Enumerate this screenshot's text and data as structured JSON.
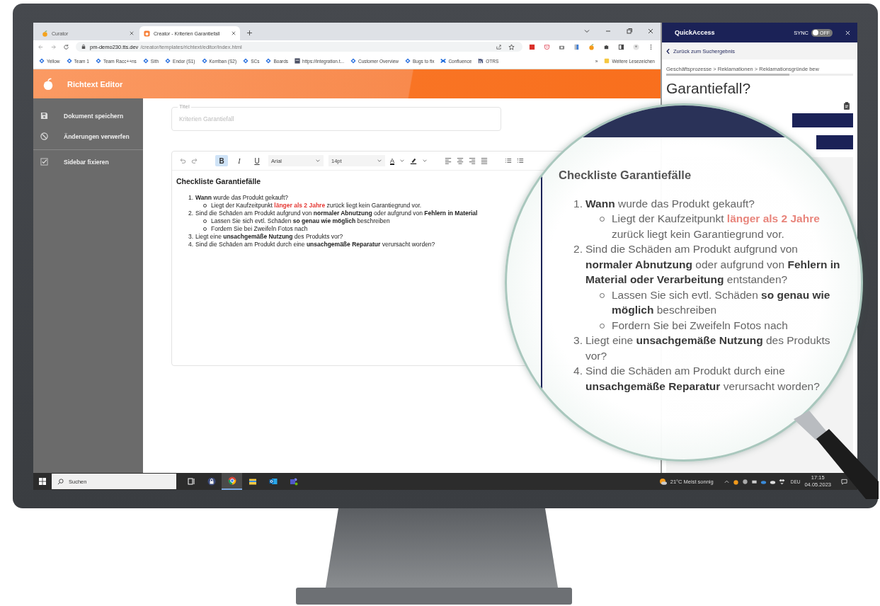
{
  "browser": {
    "tabs": [
      {
        "title": "Curator",
        "kind": "curator",
        "selected": false
      },
      {
        "title": "Creator - Kriterien Garantiefall",
        "kind": "creator",
        "selected": true
      }
    ],
    "url": {
      "host": "pm-demo230.tts.dev",
      "path": "/creator/templates/richtext/editor/index.html"
    },
    "bookmarks": [
      {
        "label": "Yellow",
        "kind": "diamond"
      },
      {
        "label": "Team 1",
        "kind": "diamond"
      },
      {
        "label": "Team Racc++ns",
        "kind": "diamond"
      },
      {
        "label": "Sith",
        "kind": "diamond"
      },
      {
        "label": "Endor (S1)",
        "kind": "diamond"
      },
      {
        "label": "Korriban (S2)",
        "kind": "diamond"
      },
      {
        "label": "SCs",
        "kind": "diamond"
      },
      {
        "label": "Boards",
        "kind": "diamond"
      },
      {
        "label": "https://integration.t...",
        "kind": "tts"
      },
      {
        "label": "Customer Overview",
        "kind": "diamond"
      },
      {
        "label": "Bugs to fix",
        "kind": "diamond"
      },
      {
        "label": "Confluence",
        "kind": "confluence"
      },
      {
        "label": "OTRS",
        "kind": "ttsmark"
      }
    ],
    "more": "»",
    "other_bookmarks": "Weitere Lesezeichen"
  },
  "app": {
    "title": "Richtext Editor",
    "sidebar": [
      {
        "label": "Dokument speichern",
        "kind": "save"
      },
      {
        "label": "Änderungen verwerfen",
        "kind": "discard"
      },
      {
        "label": "Sidebar fixieren",
        "kind": "checkbox",
        "checked": true
      }
    ],
    "title_field": {
      "label": "Titel",
      "value": "Kriterien Garantiefall"
    },
    "toolbar": {
      "format_buttons": [
        {
          "label": "B",
          "kind": "bold",
          "selected": true
        },
        {
          "label": "I",
          "kind": "italic",
          "selected": false
        },
        {
          "label": "U",
          "kind": "underline",
          "selected": false
        }
      ],
      "font": "Arial",
      "size": "14pt",
      "text_color": "A"
    },
    "document": {
      "heading": "Checkliste Garantiefälle",
      "items": [
        {
          "marker": "1.",
          "segments": [
            {
              "text": "Wann",
              "bold": true
            },
            {
              "text": " wurde das Produkt gekauft?",
              "bold": false
            }
          ],
          "children": [
            {
              "segments": [
                {
                  "text": "Liegt der Kaufzeitpunkt ",
                  "bold": false
                },
                {
                  "text": "länger als 2 Jahre",
                  "bold": true,
                  "color": "#e53935"
                },
                {
                  "text": " zurück liegt kein Garantiegrund vor.",
                  "bold": false
                }
              ]
            }
          ]
        },
        {
          "marker": "2.",
          "segments": [
            {
              "text": "Sind die Schäden am Produkt aufgrund von ",
              "bold": false
            },
            {
              "text": "normaler Abnutzung",
              "bold": true
            },
            {
              "text": " oder aufgrund von ",
              "bold": false
            },
            {
              "text": "Fehlern in Material",
              "bold": true
            }
          ],
          "children": [
            {
              "segments": [
                {
                  "text": "Lassen Sie sich evtl. Schäden ",
                  "bold": false
                },
                {
                  "text": "so genau wie möglich",
                  "bold": true
                },
                {
                  "text": " beschreiben",
                  "bold": false
                }
              ]
            },
            {
              "segments": [
                {
                  "text": "Fordern Sie bei Zweifeln Fotos nach",
                  "bold": false
                }
              ]
            }
          ]
        },
        {
          "marker": "3.",
          "segments": [
            {
              "text": "Liegt eine ",
              "bold": false
            },
            {
              "text": "unsachgemäße Nutzung",
              "bold": true
            },
            {
              "text": " des Produkts vor?",
              "bold": false
            }
          ]
        },
        {
          "marker": "4.",
          "segments": [
            {
              "text": "Sind die Schäden am Produkt durch eine ",
              "bold": false
            },
            {
              "text": "unsachgemäße Reparatur",
              "bold": true
            },
            {
              "text": " verursacht worden?",
              "bold": false
            }
          ]
        }
      ]
    }
  },
  "quickaccess": {
    "title": "QuickAccess",
    "sync_label": "SYNC",
    "sync": {
      "on": false,
      "label": "OFF"
    },
    "back": "Zurück zum Suchergebnis",
    "breadcrumb": "Geschäftsprozesse > Reklamationen > Reklamationsgründe bew",
    "heading": "Garantiefall?"
  },
  "taskbar": {
    "search": "Suchen",
    "apps": [
      {
        "kind": "taskview",
        "selected": false
      },
      {
        "kind": "lock",
        "selected": false
      },
      {
        "kind": "chrome",
        "selected": true
      },
      {
        "kind": "folder",
        "selected": false
      },
      {
        "kind": "outlook",
        "selected": false
      },
      {
        "kind": "teams",
        "selected": false
      }
    ],
    "weather": "21°C  Meist sonnig",
    "language": "DEU",
    "time": "17:15",
    "date": "04.05.2023"
  },
  "magnifier": {
    "heading": "Checkliste Garantiefälle",
    "items": [
      {
        "marker": "1.",
        "segments": [
          {
            "text": "Wann",
            "bold": true
          },
          {
            "text": " wurde das Produkt gekauft?",
            "bold": false
          }
        ],
        "children": [
          {
            "segments": [
              {
                "text": "Liegt der Kaufzeitpunkt ",
                "bold": false
              },
              {
                "text": "länger als 2 Jahre",
                "bold": true,
                "color": "#e8857c"
              },
              {
                "text": " zurück liegt kein Garantiegrund vor.",
                "bold": false
              }
            ]
          }
        ]
      },
      {
        "marker": "2.",
        "segments": [
          {
            "text": "Sind die Schäden am Produkt aufgrund von ",
            "bold": false
          },
          {
            "text": "normaler Abnutzung",
            "bold": true
          },
          {
            "text": " oder aufgrund von ",
            "bold": false
          },
          {
            "text": "Fehlern in Material oder Verarbeitung",
            "bold": true
          },
          {
            "text": " entstanden?",
            "bold": false
          }
        ],
        "children": [
          {
            "segments": [
              {
                "text": "Lassen Sie sich evtl. Schäden ",
                "bold": false
              },
              {
                "text": "so genau wie möglich",
                "bold": true
              },
              {
                "text": " beschreiben",
                "bold": false
              }
            ]
          },
          {
            "segments": [
              {
                "text": "Fordern Sie bei Zweifeln Fotos nach",
                "bold": false
              }
            ]
          }
        ]
      },
      {
        "marker": "3.",
        "segments": [
          {
            "text": "Liegt eine ",
            "bold": false
          },
          {
            "text": "unsachgemäße Nutzung",
            "bold": true
          },
          {
            "text": " des Produkts vor?",
            "bold": false
          }
        ]
      },
      {
        "marker": "4.",
        "segments": [
          {
            "text": "Sind die Schäden am Produkt durch eine ",
            "bold": false
          },
          {
            "text": "unsachgemäße Reparatur",
            "bold": true
          },
          {
            "text": " verursacht worden?",
            "bold": false
          }
        ]
      }
    ]
  }
}
